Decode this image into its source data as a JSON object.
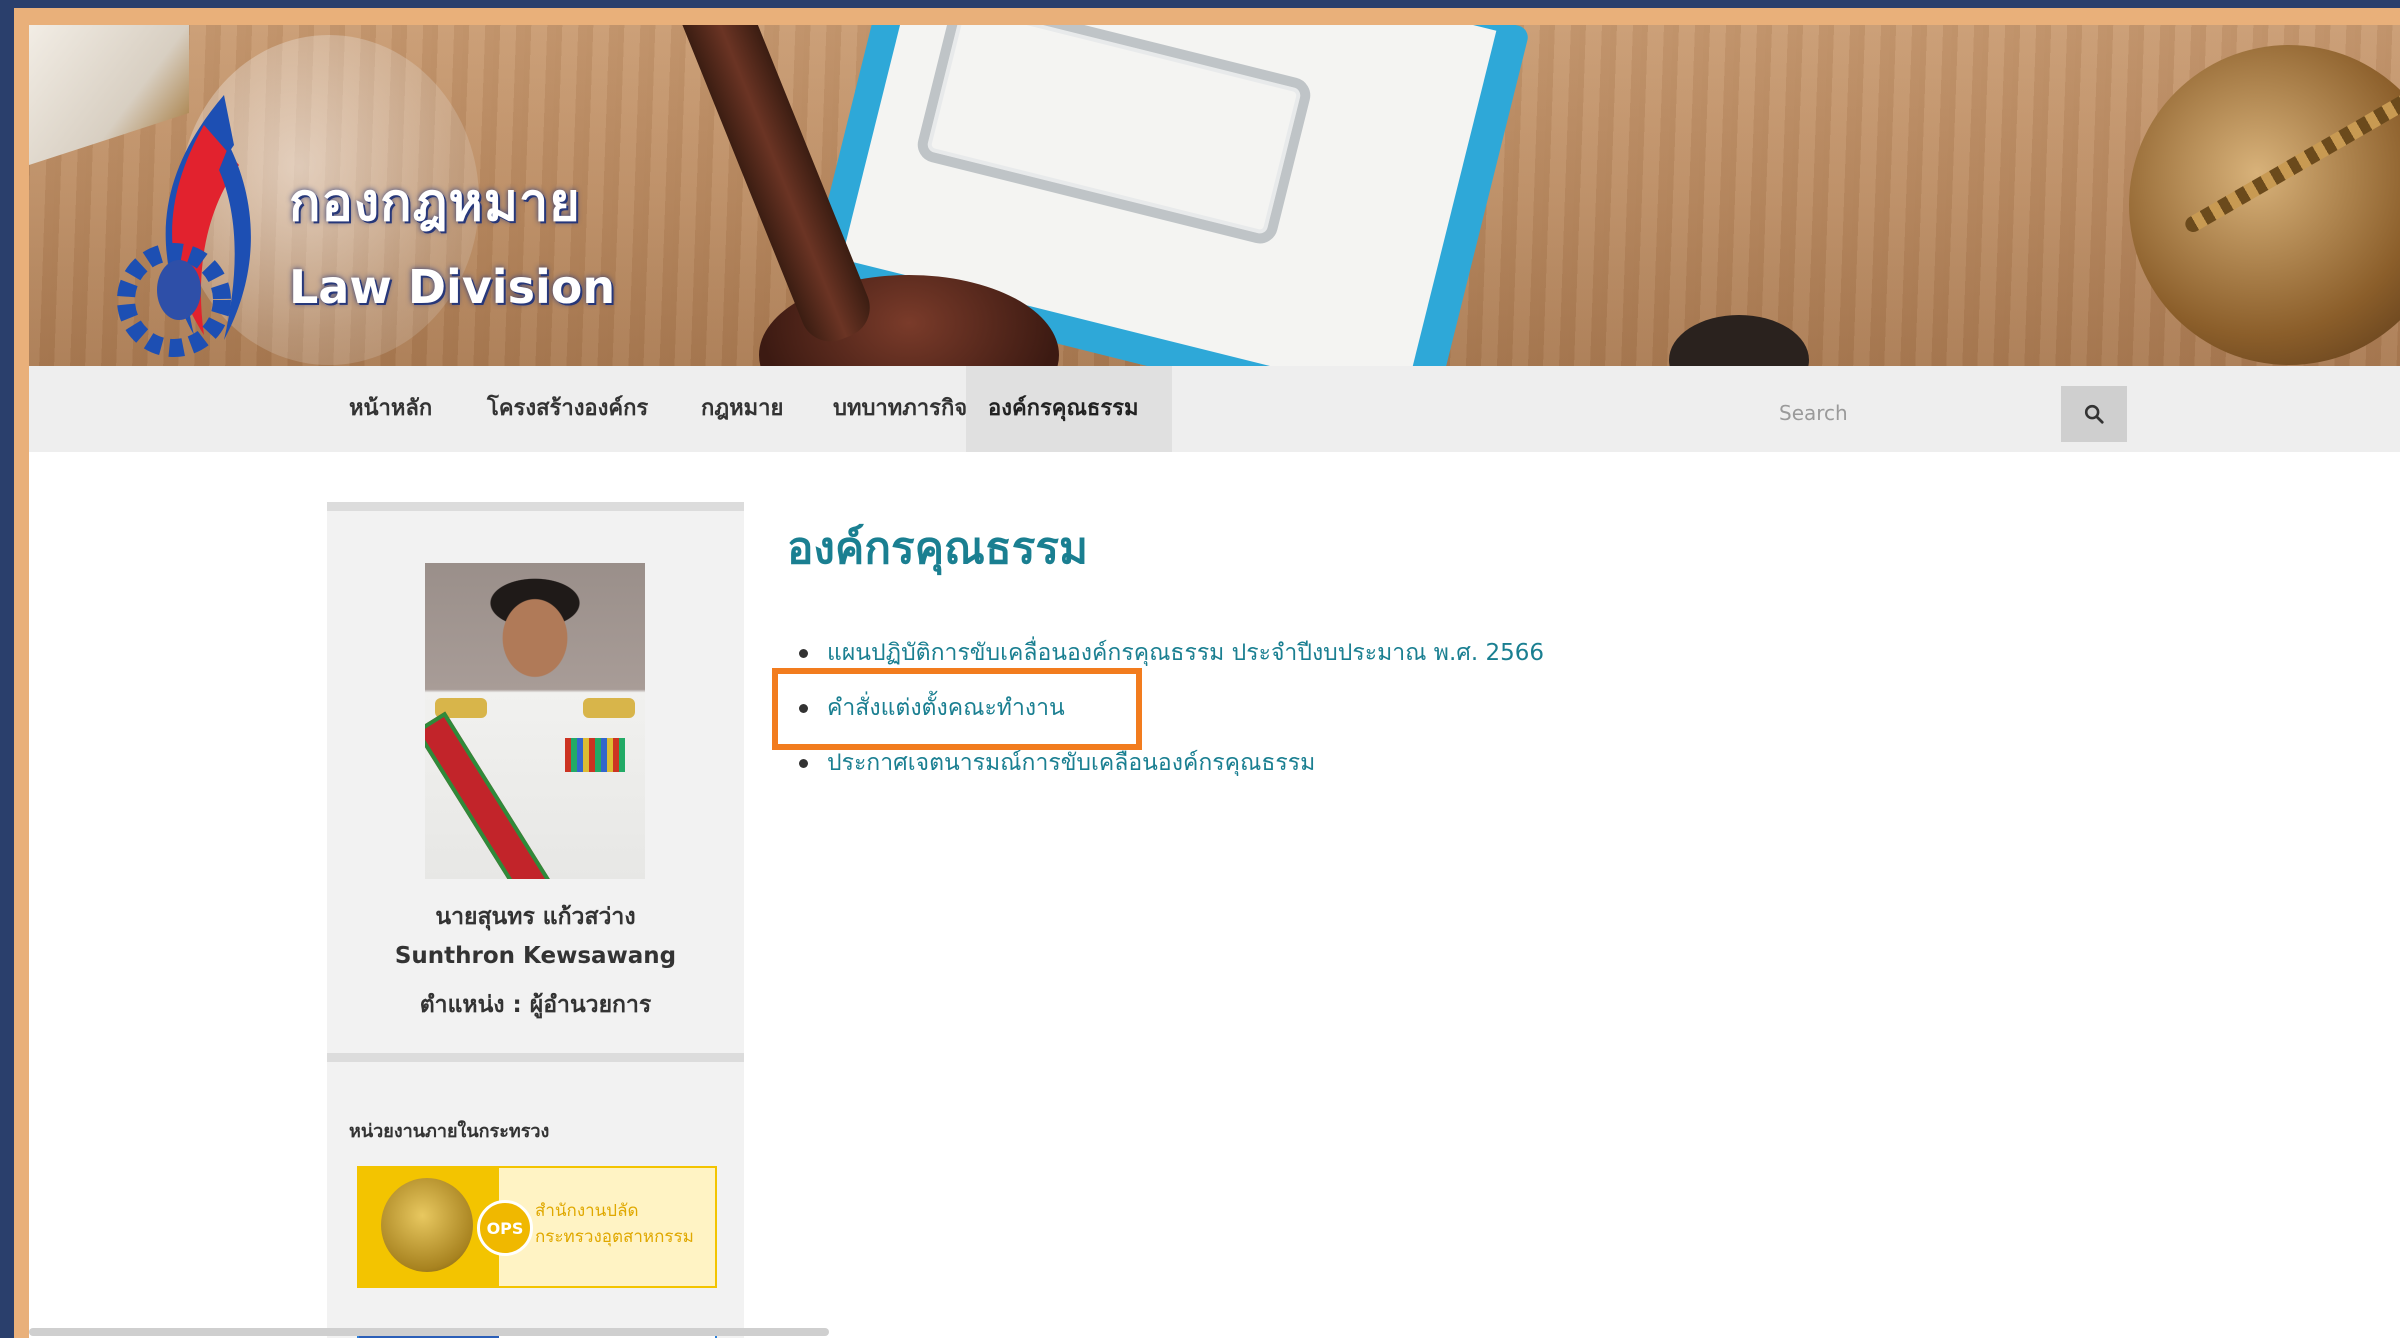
{
  "header": {
    "logo_th": "กองกฎหมาย",
    "logo_en": "Law Division"
  },
  "nav": {
    "items": [
      {
        "label": "หน้าหลัก"
      },
      {
        "label": "โครงสร้างองค์กร"
      },
      {
        "label": "กฎหมาย"
      },
      {
        "label": "บทบาทภารกิจ"
      },
      {
        "label": "องค์กรคุณธรรม",
        "active": true
      }
    ],
    "search_placeholder": "Search",
    "search_icon": "search-icon"
  },
  "sidebar": {
    "profile": {
      "name_th": "นายสุนทร แก้วสว่าง",
      "name_en": "Sunthron Kewsawang",
      "position": "ตำแหน่ง : ผู้อำนวยการ"
    },
    "units": {
      "title": "หน่วยงานภายในกระทรวง",
      "ops_badge": "OPS",
      "ops_line1": "สำนักงานปลัด",
      "ops_line2": "กระทรวงอุตสาหกรรม"
    }
  },
  "main": {
    "title": "องค์กรคุณธรรม",
    "links": [
      {
        "label": "แผนปฏิบัติการขับเคลื่อนองค์กรคุณธรรม ประจำปีงบประมาณ พ.ศ. 2566"
      },
      {
        "label": "คำสั่งแต่งตั้งคณะทำงาน"
      },
      {
        "label": "ประกาศเจตนารมณ์การขับเคลื่อนองค์กรคุณธรรม"
      }
    ],
    "highlight_color": "#f27c1e"
  },
  "colors": {
    "accent": "#1a7f91",
    "nav_bg": "#eeeeee",
    "outer_frame": "#2a3f6c"
  }
}
